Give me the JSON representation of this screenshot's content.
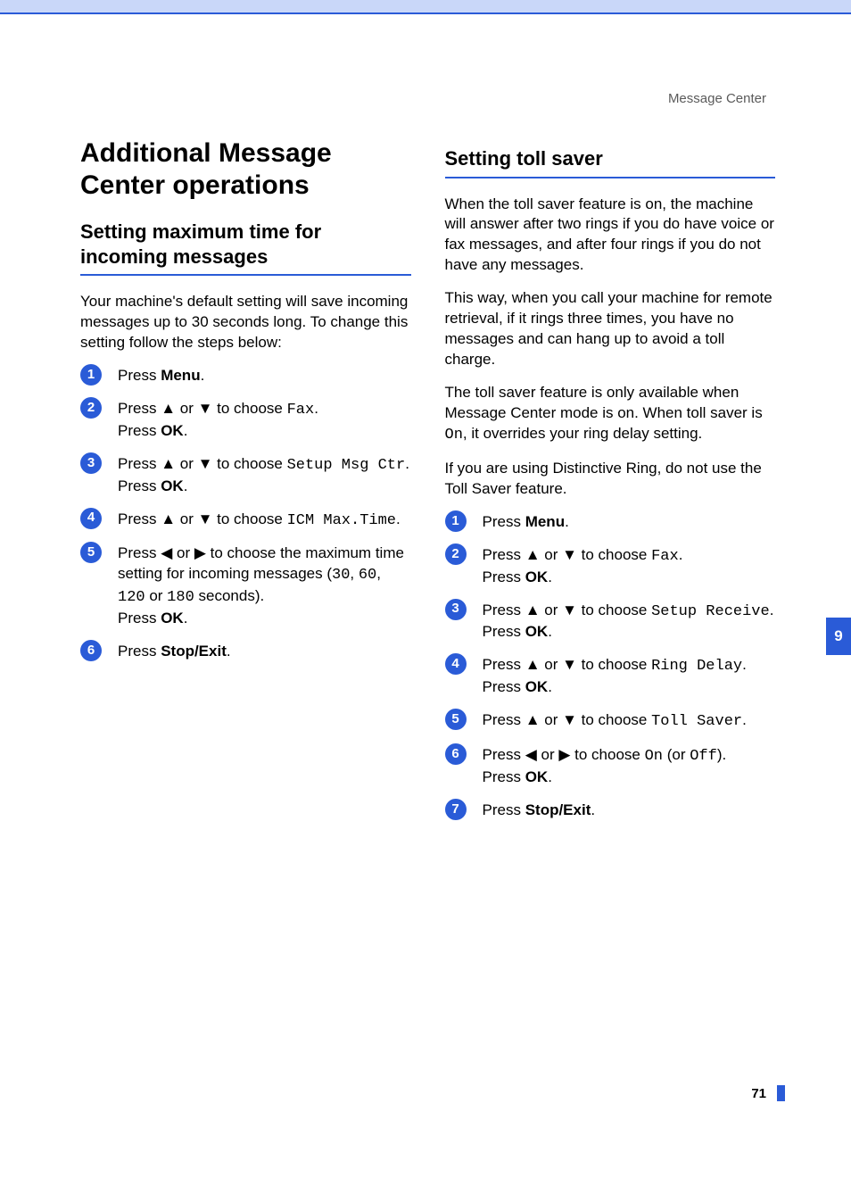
{
  "running_head": "Message Center",
  "main_heading": "Additional Message Center operations",
  "left": {
    "heading": "Setting maximum time for incoming messages",
    "intro": "Your machine's default setting will save incoming messages up to 30 seconds long. To change this setting follow the steps below:",
    "steps": [
      {
        "n": "1",
        "frags": [
          {
            "t": "Press "
          },
          {
            "t": "Menu",
            "b": true
          },
          {
            "t": "."
          }
        ]
      },
      {
        "n": "2",
        "frags": [
          {
            "t": "Press "
          },
          {
            "t": "▲",
            "cls": "arrow"
          },
          {
            "t": " or "
          },
          {
            "t": "▼",
            "cls": "arrow"
          },
          {
            "t": " to choose "
          },
          {
            "t": "Fax",
            "m": true
          },
          {
            "t": ".\nPress "
          },
          {
            "t": "OK",
            "b": true
          },
          {
            "t": "."
          }
        ]
      },
      {
        "n": "3",
        "frags": [
          {
            "t": "Press "
          },
          {
            "t": "▲",
            "cls": "arrow"
          },
          {
            "t": " or "
          },
          {
            "t": "▼",
            "cls": "arrow"
          },
          {
            "t": " to choose "
          },
          {
            "t": "Setup Msg Ctr",
            "m": true
          },
          {
            "t": ".\nPress "
          },
          {
            "t": "OK",
            "b": true
          },
          {
            "t": "."
          }
        ]
      },
      {
        "n": "4",
        "frags": [
          {
            "t": "Press "
          },
          {
            "t": "▲",
            "cls": "arrow"
          },
          {
            "t": " or "
          },
          {
            "t": "▼",
            "cls": "arrow"
          },
          {
            "t": " to choose "
          },
          {
            "t": "ICM Max.Time",
            "m": true
          },
          {
            "t": "."
          }
        ]
      },
      {
        "n": "5",
        "frags": [
          {
            "t": "Press "
          },
          {
            "t": "◀",
            "cls": "arrow"
          },
          {
            "t": " or "
          },
          {
            "t": "▶",
            "cls": "arrow"
          },
          {
            "t": " to choose the maximum time setting for incoming messages ("
          },
          {
            "t": "30",
            "m": true
          },
          {
            "t": ", "
          },
          {
            "t": "60",
            "m": true
          },
          {
            "t": ", "
          },
          {
            "t": "120",
            "m": true
          },
          {
            "t": " or "
          },
          {
            "t": "180",
            "m": true
          },
          {
            "t": " seconds).\nPress "
          },
          {
            "t": "OK",
            "b": true
          },
          {
            "t": "."
          }
        ]
      },
      {
        "n": "6",
        "frags": [
          {
            "t": "Press "
          },
          {
            "t": "Stop/Exit",
            "b": true
          },
          {
            "t": "."
          }
        ]
      }
    ]
  },
  "right": {
    "heading": "Setting toll saver",
    "paras": [
      "When the toll saver feature is on, the machine will answer after two rings if you do have voice or fax messages, and after four rings if you do not have any messages.",
      "This way, when you call your machine for remote retrieval, if it rings three times, you have no messages and can hang up to avoid a toll charge.",
      "If you are using Distinctive Ring, do not use the Toll Saver feature."
    ],
    "para3_frags": [
      {
        "t": "The toll saver feature is only available when Message Center  mode is on. When toll saver is "
      },
      {
        "t": "On",
        "m": true
      },
      {
        "t": ", it overrides your ring delay setting."
      }
    ],
    "steps": [
      {
        "n": "1",
        "frags": [
          {
            "t": "Press "
          },
          {
            "t": "Menu",
            "b": true
          },
          {
            "t": "."
          }
        ]
      },
      {
        "n": "2",
        "frags": [
          {
            "t": "Press "
          },
          {
            "t": "▲",
            "cls": "arrow"
          },
          {
            "t": " or "
          },
          {
            "t": "▼",
            "cls": "arrow"
          },
          {
            "t": " to choose "
          },
          {
            "t": "Fax",
            "m": true
          },
          {
            "t": ".\nPress "
          },
          {
            "t": "OK",
            "b": true
          },
          {
            "t": "."
          }
        ]
      },
      {
        "n": "3",
        "frags": [
          {
            "t": "Press "
          },
          {
            "t": "▲",
            "cls": "arrow"
          },
          {
            "t": " or "
          },
          {
            "t": "▼",
            "cls": "arrow"
          },
          {
            "t": " to choose "
          },
          {
            "t": "Setup Receive",
            "m": true
          },
          {
            "t": ".\nPress "
          },
          {
            "t": "OK",
            "b": true
          },
          {
            "t": "."
          }
        ]
      },
      {
        "n": "4",
        "frags": [
          {
            "t": "Press "
          },
          {
            "t": "▲",
            "cls": "arrow"
          },
          {
            "t": " or "
          },
          {
            "t": "▼",
            "cls": "arrow"
          },
          {
            "t": " to choose "
          },
          {
            "t": "Ring Delay",
            "m": true
          },
          {
            "t": ".\nPress "
          },
          {
            "t": "OK",
            "b": true
          },
          {
            "t": "."
          }
        ]
      },
      {
        "n": "5",
        "frags": [
          {
            "t": "Press "
          },
          {
            "t": "▲",
            "cls": "arrow"
          },
          {
            "t": " or "
          },
          {
            "t": "▼",
            "cls": "arrow"
          },
          {
            "t": " to choose "
          },
          {
            "t": "Toll Saver",
            "m": true
          },
          {
            "t": "."
          }
        ]
      },
      {
        "n": "6",
        "frags": [
          {
            "t": "Press "
          },
          {
            "t": "◀",
            "cls": "arrow"
          },
          {
            "t": " or "
          },
          {
            "t": "▶",
            "cls": "arrow"
          },
          {
            "t": " to choose "
          },
          {
            "t": "On",
            "m": true
          },
          {
            "t": " (or "
          },
          {
            "t": "Off",
            "m": true
          },
          {
            "t": ").\nPress "
          },
          {
            "t": "OK",
            "b": true
          },
          {
            "t": "."
          }
        ]
      },
      {
        "n": "7",
        "frags": [
          {
            "t": "Press "
          },
          {
            "t": "Stop/Exit",
            "b": true
          },
          {
            "t": "."
          }
        ]
      }
    ]
  },
  "chapter_tab": "9",
  "page_number": "71"
}
